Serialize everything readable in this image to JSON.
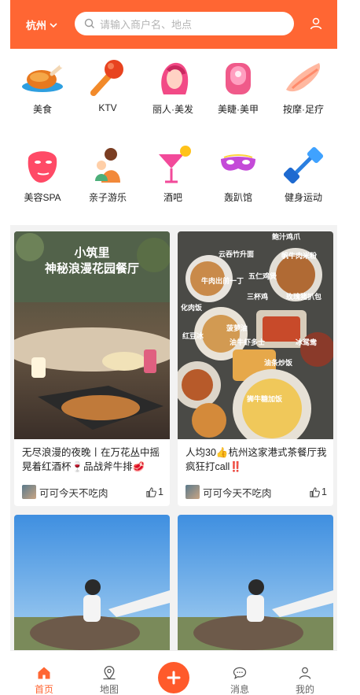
{
  "header": {
    "city": "杭州",
    "search_placeholder": "请输入商户名、地点",
    "accent": "#ff6633"
  },
  "categories": [
    {
      "label": "美食",
      "icon": "roast-chicken-icon"
    },
    {
      "label": "KTV",
      "icon": "microphone-icon"
    },
    {
      "label": "丽人·美发",
      "icon": "hair-salon-icon"
    },
    {
      "label": "美睫·美甲",
      "icon": "nail-icon"
    },
    {
      "label": "按摩·足疗",
      "icon": "massage-hand-icon"
    },
    {
      "label": "美容SPA",
      "icon": "face-mask-icon"
    },
    {
      "label": "亲子游乐",
      "icon": "parent-child-icon"
    },
    {
      "label": "酒吧",
      "icon": "cocktail-icon"
    },
    {
      "label": "轰趴馆",
      "icon": "party-mask-icon"
    },
    {
      "label": "健身运动",
      "icon": "dumbbell-icon"
    }
  ],
  "feed": [
    {
      "image_text": [
        "小筑里",
        "神秘浪漫花园餐厅"
      ],
      "title": "无尽浪漫的夜晚丨在万花丛中摇晃着红酒杯🍷品战斧牛排🥩",
      "author": "可可今天不吃肉",
      "likes": "1"
    },
    {
      "image_text": [
        "鲍汁鸡爪",
        "云吞竹升面",
        "帆牛肉米粉",
        "牛肉出前一丁",
        "五仁鸡煲",
        "化肉饭",
        "三杯鸡",
        "玫瑰猪扒包",
        "红豆冰",
        "菠萝油",
        "油牛虾多士",
        "冰鸳鸯",
        "油条炒饭",
        "狮牛糖加饭"
      ],
      "title": "人均30👍杭州这家港式茶餐厅我疯狂打call‼️",
      "author": "可可今天不吃肉",
      "likes": "1"
    },
    {
      "title": "",
      "author": "",
      "likes": ""
    },
    {
      "title": "",
      "author": "",
      "likes": ""
    }
  ],
  "bottom_nav": [
    {
      "label": "首页",
      "icon": "home-icon"
    },
    {
      "label": "地图",
      "icon": "map-pin-icon"
    },
    {
      "label": "",
      "icon": "plus-icon"
    },
    {
      "label": "消息",
      "icon": "chat-bubble-icon"
    },
    {
      "label": "我的",
      "icon": "user-icon"
    }
  ]
}
